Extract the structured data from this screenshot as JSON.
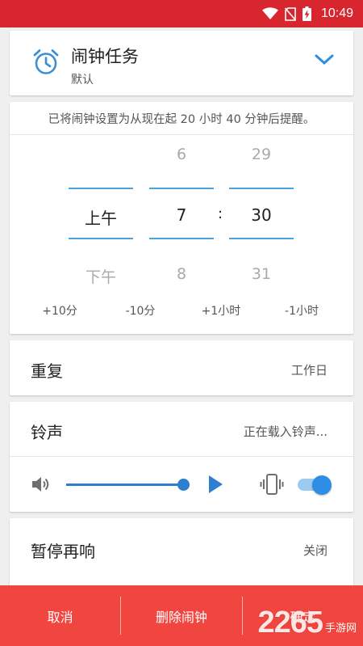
{
  "status_bar": {
    "time": "10:49",
    "icons": [
      "wifi-icon",
      "no-sim-icon",
      "battery-charging-icon"
    ]
  },
  "header": {
    "title": "闹钟任务",
    "subtitle": "默认",
    "icon": "alarm-clock-icon",
    "expand_icon": "chevron-down-icon"
  },
  "time_picker": {
    "info": "已将闹钟设置为从现在起 20 小时 40 分钟后提醒。",
    "ampm": {
      "prev": "",
      "current": "上午",
      "next": "下午"
    },
    "hour": {
      "prev": "6",
      "current": "7",
      "next": "8"
    },
    "minute": {
      "prev": "29",
      "current": "30",
      "next": "31"
    },
    "separator": ":",
    "adjust_buttons": [
      "+10分",
      "-10分",
      "+1小时",
      "-1小时"
    ]
  },
  "repeat": {
    "label": "重复",
    "value": "工作日"
  },
  "ringtone": {
    "label": "铃声",
    "value": "正在载入铃声...",
    "volume": 1.0,
    "vibrate_enabled": true
  },
  "snooze": {
    "label": "暂停再响",
    "value": "关闭"
  },
  "bottom_bar": {
    "cancel": "取消",
    "delete": "删除闹钟",
    "confirm": "确定"
  },
  "watermark": {
    "number": "2265",
    "text": "手游网"
  },
  "colors": {
    "status_bar": "#d8262f",
    "bottom_bar": "#f1453f",
    "accent": "#2e8de4",
    "picker_line": "#4aa3df"
  }
}
